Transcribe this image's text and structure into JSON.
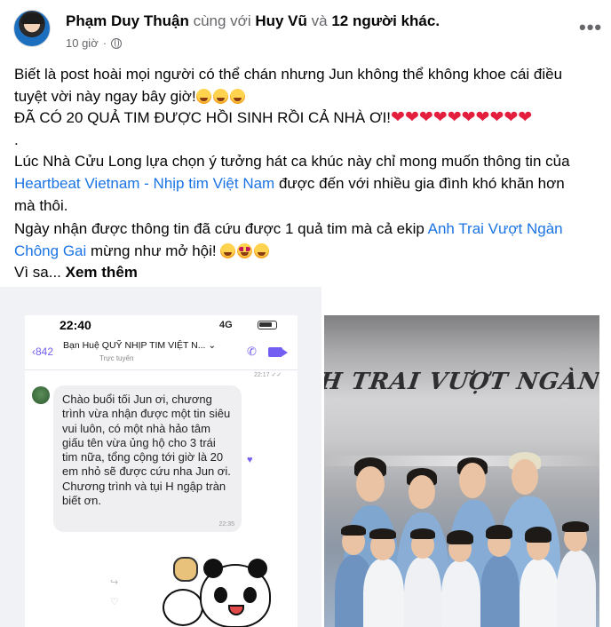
{
  "post": {
    "author": "Phạm Duy Thuận",
    "with_text": "cùng với",
    "tagged_user": "Huy Vũ",
    "and_text": "và",
    "others": "12 người khác.",
    "time": "10 giờ",
    "time_separator": "·",
    "more_label": "•••",
    "avatar_icon": "profile-avatar-icon",
    "privacy_icon": "globe-icon",
    "body": {
      "line1": "Biết là post hoài mọi người có thể chán nhưng Jun không thể không khoe cái điều",
      "line2": "tuyệt vời này ngay bây giờ!",
      "line3": "ĐÃ CÓ 20 QUẢ TIM ĐƯỢC HỒI SINH RỒI CẢ NHÀ ƠI!",
      "hearts": "❤❤❤❤❤❤❤❤❤❤",
      "line4": ".",
      "line5": "Lúc Nhà Cửu Long lựa chọn ý tưởng hát ca khúc này chỉ mong muốn thông tin của",
      "link1": "Heartbeat Vietnam - Nhịp tim Việt Nam",
      "line6_rest": " được đến với nhiều gia đình khó khăn hơn",
      "line7": "mà thôi.",
      "line8": "Ngày nhận được thông tin đã cứu được 1 quả tim mà cả ekip ",
      "link2a": "Anh Trai Vượt Ngàn",
      "link2b": "Chông Gai",
      "line9_rest": " mừng như mở hội! ",
      "line10": "Vì sa... ",
      "see_more": "Xem thêm"
    }
  },
  "screenshot": {
    "time": "22:40",
    "signal": "4G",
    "back_count": "842",
    "chat_name": "Bạn Huệ QUỸ NHỊP TIM VIỆT N...",
    "chevron": "⌄",
    "status": "Trực tuyến",
    "read_time": "22:17 ✓✓",
    "message": "Chào buổi tối Jun ơi, chương trình vừa nhận được một tin siêu vui luôn, có một nhà hảo tâm giấu tên vừa ủng hộ cho 3 trái tim nữa, tổng cộng tới giờ là 20 em nhỏ sẽ được cứu nha Jun ơi. Chương trình và tụi H ngập tràn biết ơn.",
    "message_time": "22:35",
    "reaction": "♥"
  },
  "photo": {
    "banner_text": "H TRAI VƯỢT NGÀN CHÔNG G"
  }
}
